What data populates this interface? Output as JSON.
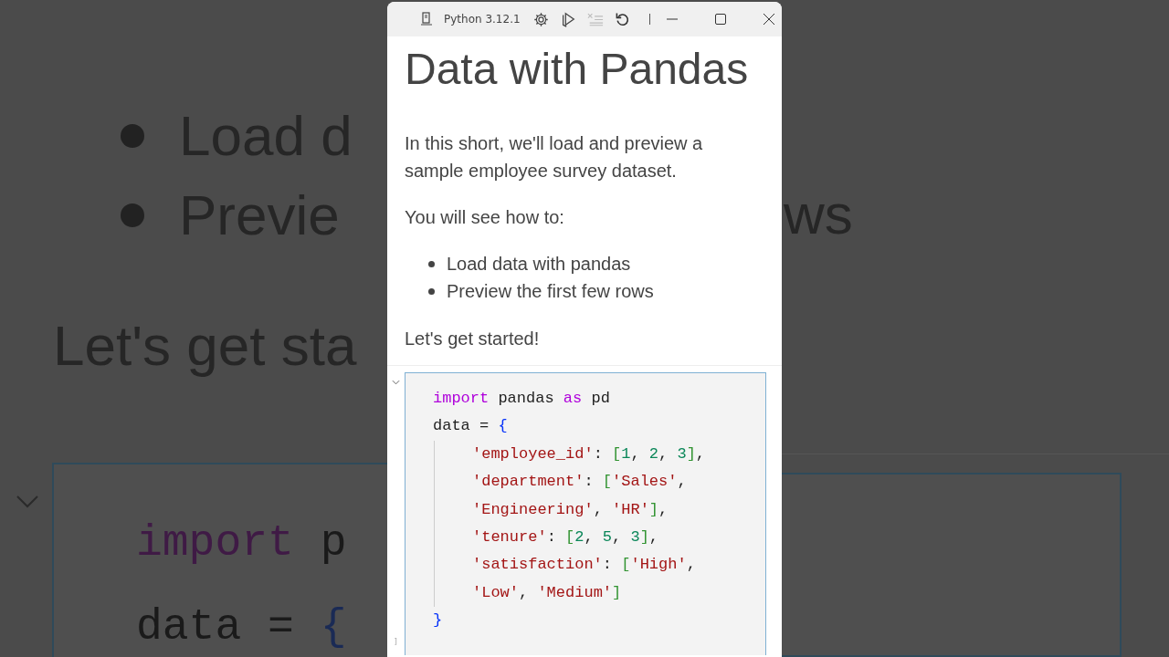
{
  "backdrop": {
    "left": {
      "bullets": [
        "Load d",
        "Previe"
      ],
      "paragraph": "Let's get sta",
      "code_lines": [
        [
          {
            "kind": "keyword",
            "text": "import"
          },
          {
            "kind": "plain",
            "text": " p"
          }
        ],
        [
          {
            "kind": "plain",
            "text": "data = "
          },
          {
            "kind": "brace",
            "text": "{"
          }
        ]
      ]
    },
    "right": {
      "bullet_tail": "ws"
    }
  },
  "window": {
    "kernel": "Python 3.12.1",
    "clear_disabled": true
  },
  "markdown": {
    "title": "Data with Pandas",
    "intro": "In this short, we'll load and preview a sample employee survey dataset.",
    "lead": "You will see how to:",
    "bullets": [
      "Load data with pandas",
      "Preview the first few rows"
    ],
    "closing": "Let's get started!"
  },
  "code_cell": {
    "expanded": true,
    "marker": "]",
    "lines": [
      {
        "indent": false,
        "tokens": [
          {
            "kind": "keyword",
            "text": "import"
          },
          {
            "kind": "plain",
            "text": " pandas "
          },
          {
            "kind": "keyword",
            "text": "as"
          },
          {
            "kind": "plain",
            "text": " pd"
          }
        ]
      },
      {
        "indent": false,
        "tokens": [
          {
            "kind": "plain",
            "text": "data = "
          },
          {
            "kind": "brace",
            "text": "{"
          }
        ]
      },
      {
        "indent": true,
        "tokens": [
          {
            "kind": "string",
            "text": "'employee_id'"
          },
          {
            "kind": "plain",
            "text": ": "
          },
          {
            "kind": "bracket",
            "text": "["
          },
          {
            "kind": "number",
            "text": "1"
          },
          {
            "kind": "plain",
            "text": ", "
          },
          {
            "kind": "number",
            "text": "2"
          },
          {
            "kind": "plain",
            "text": ", "
          },
          {
            "kind": "number",
            "text": "3"
          },
          {
            "kind": "bracket",
            "text": "]"
          },
          {
            "kind": "plain",
            "text": ","
          }
        ]
      },
      {
        "indent": true,
        "tokens": [
          {
            "kind": "string",
            "text": "'department'"
          },
          {
            "kind": "plain",
            "text": ": "
          },
          {
            "kind": "bracket",
            "text": "["
          },
          {
            "kind": "string",
            "text": "'Sales'"
          },
          {
            "kind": "plain",
            "text": ","
          }
        ]
      },
      {
        "indent": true,
        "tokens": [
          {
            "kind": "string",
            "text": "'Engineering'"
          },
          {
            "kind": "plain",
            "text": ", "
          },
          {
            "kind": "string",
            "text": "'HR'"
          },
          {
            "kind": "bracket",
            "text": "]"
          },
          {
            "kind": "plain",
            "text": ","
          }
        ]
      },
      {
        "indent": true,
        "tokens": [
          {
            "kind": "string",
            "text": "'tenure'"
          },
          {
            "kind": "plain",
            "text": ": "
          },
          {
            "kind": "bracket",
            "text": "["
          },
          {
            "kind": "number",
            "text": "2"
          },
          {
            "kind": "plain",
            "text": ", "
          },
          {
            "kind": "number",
            "text": "5"
          },
          {
            "kind": "plain",
            "text": ", "
          },
          {
            "kind": "number",
            "text": "3"
          },
          {
            "kind": "bracket",
            "text": "]"
          },
          {
            "kind": "plain",
            "text": ","
          }
        ]
      },
      {
        "indent": true,
        "tokens": [
          {
            "kind": "string",
            "text": "'satisfaction'"
          },
          {
            "kind": "plain",
            "text": ": "
          },
          {
            "kind": "bracket",
            "text": "["
          },
          {
            "kind": "string",
            "text": "'High'"
          },
          {
            "kind": "plain",
            "text": ","
          }
        ]
      },
      {
        "indent": true,
        "tokens": [
          {
            "kind": "string",
            "text": "'Low'"
          },
          {
            "kind": "plain",
            "text": ", "
          },
          {
            "kind": "string",
            "text": "'Medium'"
          },
          {
            "kind": "bracket",
            "text": "]"
          }
        ]
      },
      {
        "indent": false,
        "tokens": [
          {
            "kind": "brace",
            "text": "}"
          }
        ]
      }
    ]
  }
}
